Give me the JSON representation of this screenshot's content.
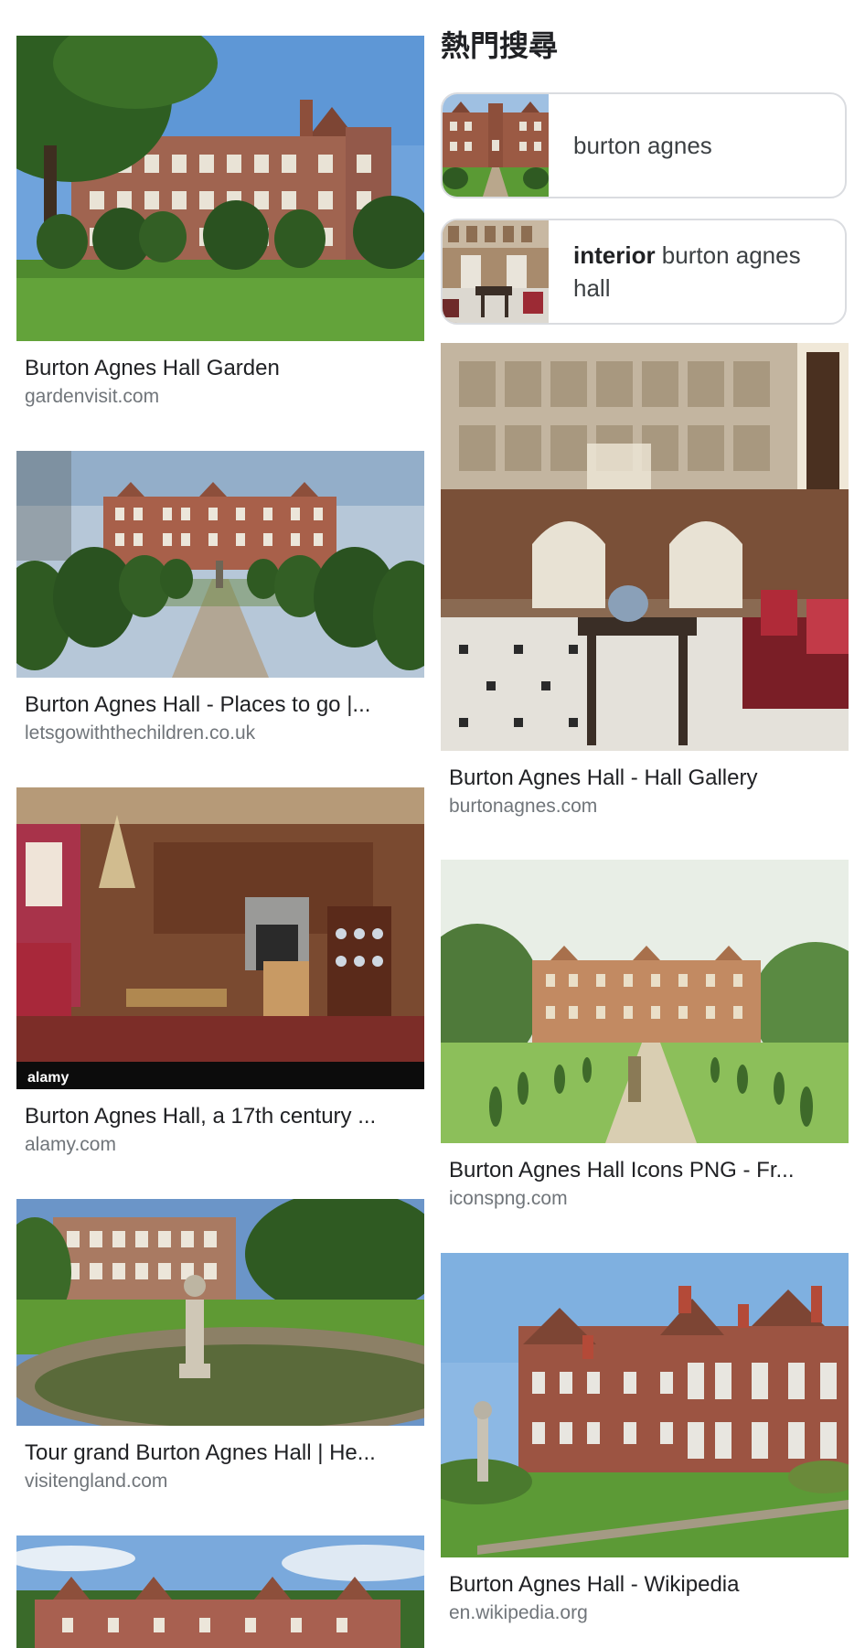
{
  "trending": {
    "heading": "熱門搜尋",
    "chips": [
      {
        "bold": "",
        "text": "burton agnes",
        "thumb_icon": "hall-exterior-thumbnail"
      },
      {
        "bold": "interior",
        "text": " burton agnes hall",
        "thumb_icon": "hall-interior-thumbnail"
      }
    ]
  },
  "results_left": [
    {
      "title": "Burton Agnes Hall Garden",
      "domain": "gardenvisit.com",
      "image": "hall-with-topiary-garden"
    },
    {
      "title": "Burton Agnes Hall - Places to go |...",
      "domain": "letsgowiththechildren.co.uk",
      "image": "hall-topiary-avenue"
    },
    {
      "title": "Burton Agnes Hall, a 17th century ...",
      "domain": "alamy.com",
      "image": "drawing-room-interior",
      "watermark": "alamy"
    },
    {
      "title": "Tour grand Burton Agnes Hall | He...",
      "domain": "visitengland.com",
      "image": "hall-with-fountain-pond"
    },
    {
      "title": "",
      "domain": "",
      "image": "hall-exterior-partial"
    }
  ],
  "results_right": [
    {
      "title": "Burton Agnes Hall - Hall Gallery",
      "domain": "burtonagnes.com",
      "image": "great-hall-carved-screen"
    },
    {
      "title": "Burton Agnes Hall Icons PNG - Fr...",
      "domain": "iconspng.com",
      "image": "hall-painting"
    },
    {
      "title": "Burton Agnes Hall - Wikipedia",
      "domain": "en.wikipedia.org",
      "image": "hall-brick-facade"
    }
  ],
  "colors": {
    "brick": "#9b5a44",
    "brick_dark": "#7d4534",
    "sky": "#8fb4dc",
    "lawn": "#5a9a34",
    "topiary": "#2f5a22",
    "divider": "#dadce0",
    "title_text": "#202124",
    "domain_text": "#70757a"
  }
}
